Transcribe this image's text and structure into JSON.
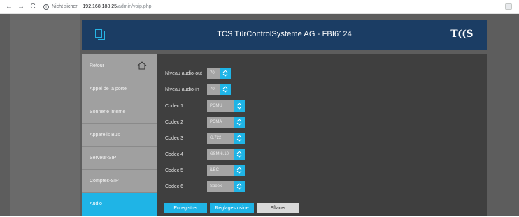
{
  "browser": {
    "back_icon": "arrow-left-icon",
    "forward_icon": "arrow-right-icon",
    "reload_icon": "reload-icon",
    "security_text": "Nicht sicher",
    "url_host": "192.168.188.25",
    "url_path": "/admin/voip.php"
  },
  "header": {
    "title": "TCS TürControlSysteme AG - FBI6124",
    "brand": "T((S",
    "color": "#1b3d64",
    "accent": "#1fb4e6"
  },
  "sidebar": {
    "items": [
      {
        "label": "Retour",
        "icon": "home-icon"
      },
      {
        "label": "Appel de la porte"
      },
      {
        "label": "Sonnerie interne"
      },
      {
        "label": "Appareils Bus"
      },
      {
        "label": "Serveur-SIP"
      },
      {
        "label": "Comptes-SIP"
      },
      {
        "label": "Audio",
        "active": true
      }
    ]
  },
  "form": {
    "rows": [
      {
        "label": "Niveau audio-out",
        "value": "70"
      },
      {
        "label": "Niveau audio-in",
        "value": "70"
      },
      {
        "label": "Codec 1",
        "value": "PCMU"
      },
      {
        "label": "Codec 2",
        "value": "PCMA"
      },
      {
        "label": "Codec 3",
        "value": "G.722"
      },
      {
        "label": "Codec 4",
        "value": "GSM 6.10"
      },
      {
        "label": "Codec 5",
        "value": "iLBC"
      },
      {
        "label": "Codec 6",
        "value": "Speex"
      }
    ]
  },
  "buttons": {
    "save": "Enregistrer",
    "factory": "Réglages usine",
    "clear": "Effacer"
  }
}
